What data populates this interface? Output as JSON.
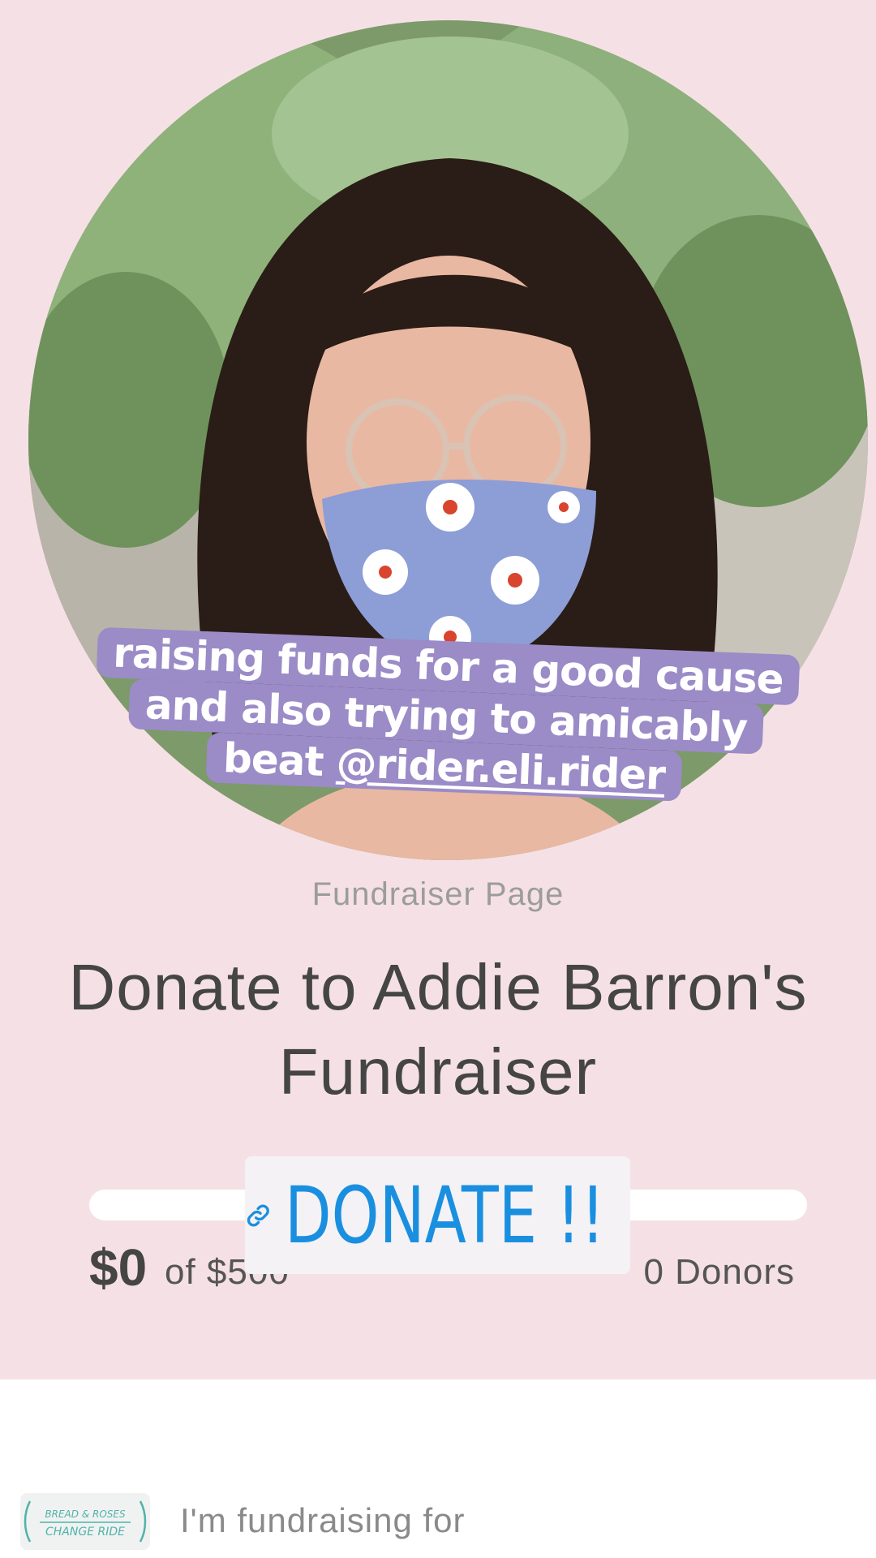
{
  "profile": {
    "photo_label": "profile-photo",
    "caption_lines": [
      "raising funds for a good cause",
      "and also trying to amicably"
    ],
    "caption_prefix": "beat ",
    "caption_mention": "@rider.eli.rider"
  },
  "page_label": "Fundraiser Page",
  "title_lines": [
    "Donate to Addie Barron's",
    "Fundraiser"
  ],
  "progress": {
    "raised": "$0",
    "goal": "of $500",
    "donors": "0 Donors",
    "fraction": 0
  },
  "donate_sticker": {
    "label": "DONATE !!",
    "icon": "link-icon",
    "color": "#1a8fe0"
  },
  "footer": {
    "fundraising_for": "I'm fundraising for",
    "org_logo_text": [
      "BREAD & ROSES",
      "CHANGE RIDE"
    ]
  },
  "colors": {
    "background": "#f5e1e5",
    "sticker_purple": "#9b8bc7"
  }
}
